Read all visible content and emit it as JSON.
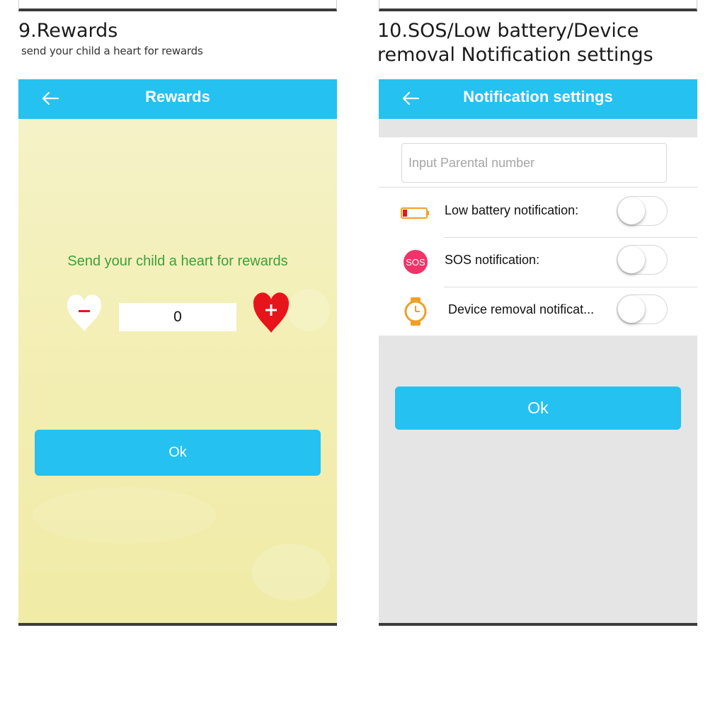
{
  "left_section": {
    "title": "9.Rewards",
    "subtitle": "send your child a heart for rewards",
    "screen": {
      "nav_title": "Rewards",
      "back_icon": "left-arrow-icon",
      "message": "Send your child a heart for rewards",
      "count_value": "0",
      "minus_icon": "heart-minus-icon",
      "plus_icon": "heart-plus-icon",
      "ok_label": "Ok"
    }
  },
  "right_section": {
    "title_line1": "10.SOS/Low battery/Device",
    "title_line2": "removal Notification settings",
    "screen": {
      "nav_title": "Notification settings",
      "back_icon": "left-arrow-icon",
      "input_placeholder": "Input Parental number",
      "input_value": "",
      "rows": [
        {
          "icon": "battery-low-icon",
          "label": "Low battery notification:",
          "enabled": false
        },
        {
          "icon": "sos-icon",
          "icon_text": "SOS",
          "label": "SOS notification:",
          "enabled": false
        },
        {
          "icon": "watch-icon",
          "label": "Device removal notificat...",
          "enabled": false
        }
      ],
      "ok_label": "Ok"
    }
  },
  "colors": {
    "accent": "#25c1f0",
    "reward_text": "#3ca13a",
    "heart_red": "#e8141c",
    "sos_pink": "#f0346a",
    "battery_red": "#e8141c",
    "watch_gold": "#f0a024"
  }
}
